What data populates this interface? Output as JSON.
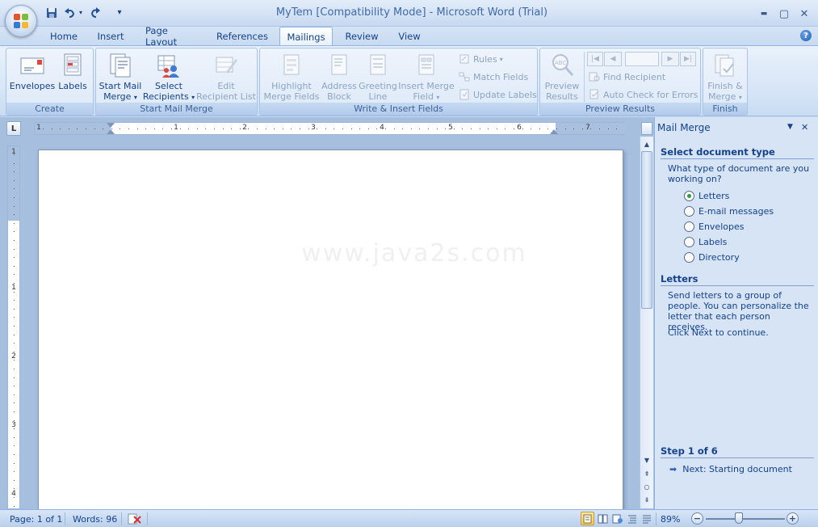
{
  "window": {
    "title": "MyTem [Compatibility Mode] - Microsoft Word (Trial)",
    "minimize_glyph": "▬",
    "maximize_glyph": "▢",
    "close_glyph": "✕"
  },
  "qat": {
    "customize_glyph": "▾"
  },
  "tabs": [
    {
      "label": "Home"
    },
    {
      "label": "Insert"
    },
    {
      "label": "Page Layout"
    },
    {
      "label": "References"
    },
    {
      "label": "Mailings",
      "active": true
    },
    {
      "label": "Review"
    },
    {
      "label": "View"
    }
  ],
  "help_glyph": "?",
  "ribbon": {
    "create": {
      "label": "Create",
      "envelopes": "Envelopes",
      "labels": "Labels"
    },
    "start_mail_merge": {
      "label": "Start Mail Merge",
      "start_line1": "Start Mail",
      "start_line2": "Merge",
      "select_line1": "Select",
      "select_line2": "Recipients",
      "edit_line1": "Edit",
      "edit_line2": "Recipient List"
    },
    "write_insert": {
      "label": "Write & Insert Fields",
      "highlight_line1": "Highlight",
      "highlight_line2": "Merge Fields",
      "address_line1": "Address",
      "address_line2": "Block",
      "greeting_line1": "Greeting",
      "greeting_line2": "Line",
      "insert_line1": "Insert Merge",
      "insert_line2": "Field",
      "rules": "Rules",
      "match_fields": "Match Fields",
      "update_labels": "Update Labels"
    },
    "preview": {
      "label": "Preview Results",
      "preview_line1": "Preview",
      "preview_line2": "Results",
      "record_value": "",
      "find_recipient": "Find Recipient",
      "auto_check": "Auto Check for Errors"
    },
    "finish": {
      "label": "Finish",
      "finish_line1": "Finish &",
      "finish_line2": "Merge"
    }
  },
  "ruler": {
    "corner_glyph": "L",
    "h_numbers": [
      "1",
      "1",
      "2",
      "3",
      "4",
      "5",
      "6",
      "7"
    ],
    "v_numbers": [
      "1",
      "1",
      "2",
      "3",
      "4"
    ]
  },
  "document": {
    "watermark": "www.java2s.com"
  },
  "taskpane": {
    "title": "Mail Merge",
    "menu_glyph": "▼",
    "close_glyph": "✕",
    "select_type_heading": "Select document type",
    "question": "What type of document are you working on?",
    "options": [
      {
        "label": "Letters",
        "checked": true
      },
      {
        "label": "E-mail messages",
        "checked": false
      },
      {
        "label": "Envelopes",
        "checked": false
      },
      {
        "label": "Labels",
        "checked": false
      },
      {
        "label": "Directory",
        "checked": false
      }
    ],
    "letters_heading": "Letters",
    "letters_desc": "Send letters to a group of people. You can personalize the letter that each person receives.",
    "click_next": "Click Next to continue.",
    "step_heading": "Step 1 of 6",
    "next_link": "Next: Starting document"
  },
  "status": {
    "page": "Page: 1 of 1",
    "words": "Words: 96",
    "zoom": "89%"
  }
}
